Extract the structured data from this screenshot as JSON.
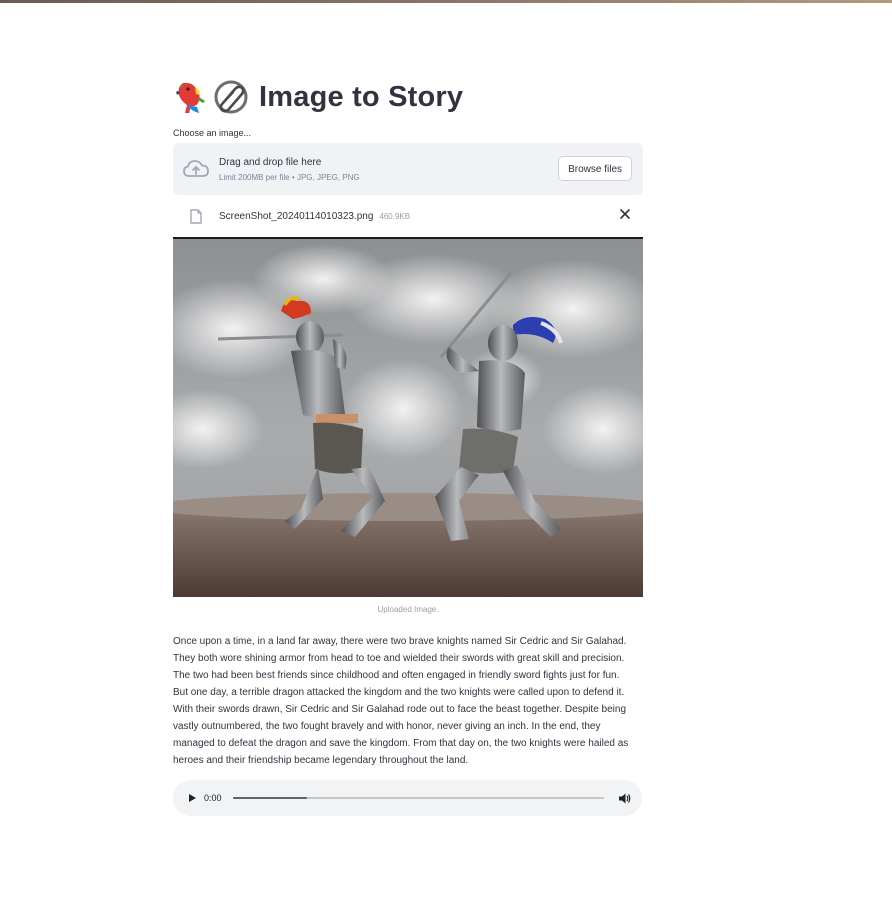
{
  "header": {
    "title": "Image to Story",
    "emoji_left": "parrot-icon",
    "emoji_right": "paperclip-icon"
  },
  "uploader": {
    "label": "Choose an image...",
    "drag_text": "Drag and drop file here",
    "limit_text": "Limit 200MB per file • JPG, JPEG, PNG",
    "browse_label": "Browse files",
    "file": {
      "name": "ScreenShot_20240114010323.png",
      "size": "460.9KB"
    }
  },
  "image": {
    "caption": "Uploaded Image."
  },
  "story": {
    "text": "Once upon a time, in a land far away, there were two brave knights named Sir Cedric and Sir Galahad. They both wore shining armor from head to toe and wielded their swords with great skill and precision. The two had been best friends since childhood and often engaged in friendly sword fights just for fun. But one day, a terrible dragon attacked the kingdom and the two knights were called upon to defend it. With their swords drawn, Sir Cedric and Sir Galahad rode out to face the beast together. Despite being vastly outnumbered, the two fought bravely and with honor, never giving an inch. In the end, they managed to defeat the dragon and save the kingdom. From that day on, the two knights were hailed as heroes and their friendship became legendary throughout the land."
  },
  "audio": {
    "time": "0:00",
    "buffered_fraction": 0.2
  },
  "colors": {
    "accent": "#ff4b4b",
    "dropzone_bg": "#f0f2f6",
    "text": "#31333f",
    "audio_bg": "#f1f3f4"
  }
}
